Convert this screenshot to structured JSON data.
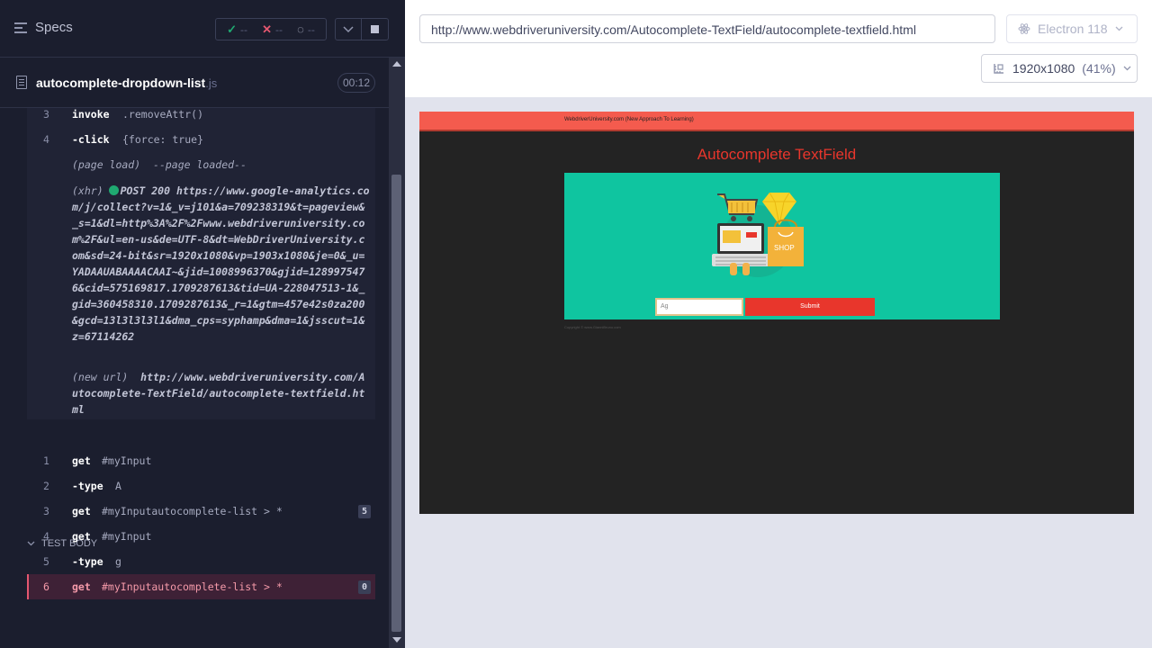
{
  "reporter": {
    "header_title": "Specs",
    "stats": {
      "passed_glyph": "✓",
      "passed": "--",
      "failed_glyph": "✕",
      "failed": "--",
      "pending_glyph": "◌",
      "pending": "--"
    },
    "spec_file": {
      "name": "autocomplete-dropdown-list",
      "ext": ".js",
      "duration": "00:12"
    },
    "before_commands": [
      {
        "num": "3",
        "name": "invoke",
        "message": ".removeAttr()"
      },
      {
        "num": "4",
        "name": "-click",
        "message": "{force: true}"
      }
    ],
    "page_load": {
      "label": "(page load)",
      "message": "--page loaded--"
    },
    "xhr": {
      "label": "(xhr)",
      "status": "POST 200",
      "url": "https://www.google-analytics.com/j/collect?v=1&_v=j101&a=709238319&t=pageview&_s=1&dl=http%3A%2F%2Fwww.webdriveruniversity.com%2F&ul=en-us&de=UTF-8&dt=WebDriverUniversity.com&sd=24-bit&sr=1920x1080&vp=1903x1080&je=0&_u=YADAAUABAAAACAAI~&jid=1008996370&gjid=1289975476&cid=575169817.1709287613&tid=UA-228047513-1&_gid=360458310.1709287613&_r=1&gtm=457e42s0za200&gcd=13l3l3l3l1&dma_cps=syphamp&dma=1&jsscut=1&z=67114262"
    },
    "new_url": {
      "label": "(new url)",
      "url": "http://www.webdriveruniversity.com/Autocomplete-TextField/autocomplete-textfield.html"
    },
    "test_body_label": "TEST BODY",
    "test_body_commands": [
      {
        "num": "1",
        "name": "get",
        "message": "#myInput",
        "badge": ""
      },
      {
        "num": "2",
        "name": "-type",
        "message": "A",
        "badge": ""
      },
      {
        "num": "3",
        "name": "get",
        "message": "#myInputautocomplete-list > *",
        "badge": "5"
      },
      {
        "num": "4",
        "name": "get",
        "message": "#myInput",
        "badge": ""
      },
      {
        "num": "5",
        "name": "-type",
        "message": "g",
        "badge": ""
      },
      {
        "num": "6",
        "name": "get",
        "message": "#myInputautocomplete-list > *",
        "badge": "0"
      }
    ]
  },
  "runner": {
    "url": "http://www.webdriveruniversity.com/Autocomplete-TextField/autocomplete-textfield.html",
    "browser": "Electron 118",
    "viewport": "1920x1080",
    "scale": "(41%)"
  },
  "aut": {
    "nav_text": "WebdriverUniversity.com (New Approach To Learning)",
    "heading": "Autocomplete TextField",
    "input_value": "Ag",
    "submit_label": "Submit",
    "shop_label": "SHOP",
    "footer": "Copyright © www.GianniBruno.com"
  },
  "colors": {
    "reporter_bg": "#1b1e2e",
    "failed_row_bg": "#3e2136",
    "failed_text": "#f59aa9",
    "xhr_dot": "#1fa971",
    "aut_nav": "#f45b4e",
    "aut_card": "#0fc5a0",
    "aut_heading": "#e8362c"
  }
}
